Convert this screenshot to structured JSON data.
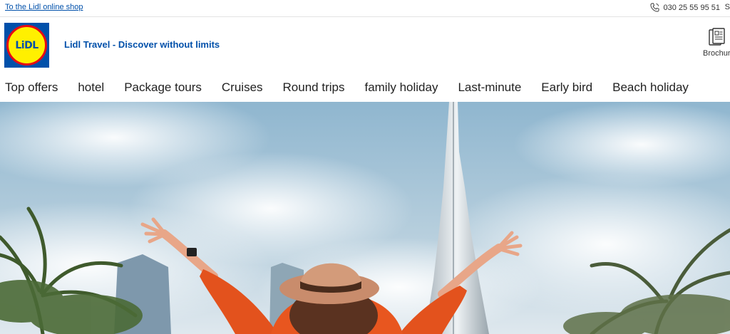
{
  "topbar": {
    "shop_link": "To the Lidl online shop",
    "phone_number": "030 25 55 95 51",
    "clipped_text": "S"
  },
  "header": {
    "logo_text": "LiDL",
    "tagline": "Lidl Travel - Discover without limits",
    "brochure_label": "Brochure"
  },
  "nav": {
    "items": [
      "Top offers",
      "hotel",
      "Package tours",
      "Cruises",
      "Round trips",
      "family holiday",
      "Last-minute",
      "Early bird",
      "Beach holiday"
    ]
  },
  "colors": {
    "brand_blue": "#0050aa",
    "brand_yellow": "#fff000",
    "brand_red": "#e60a14"
  }
}
